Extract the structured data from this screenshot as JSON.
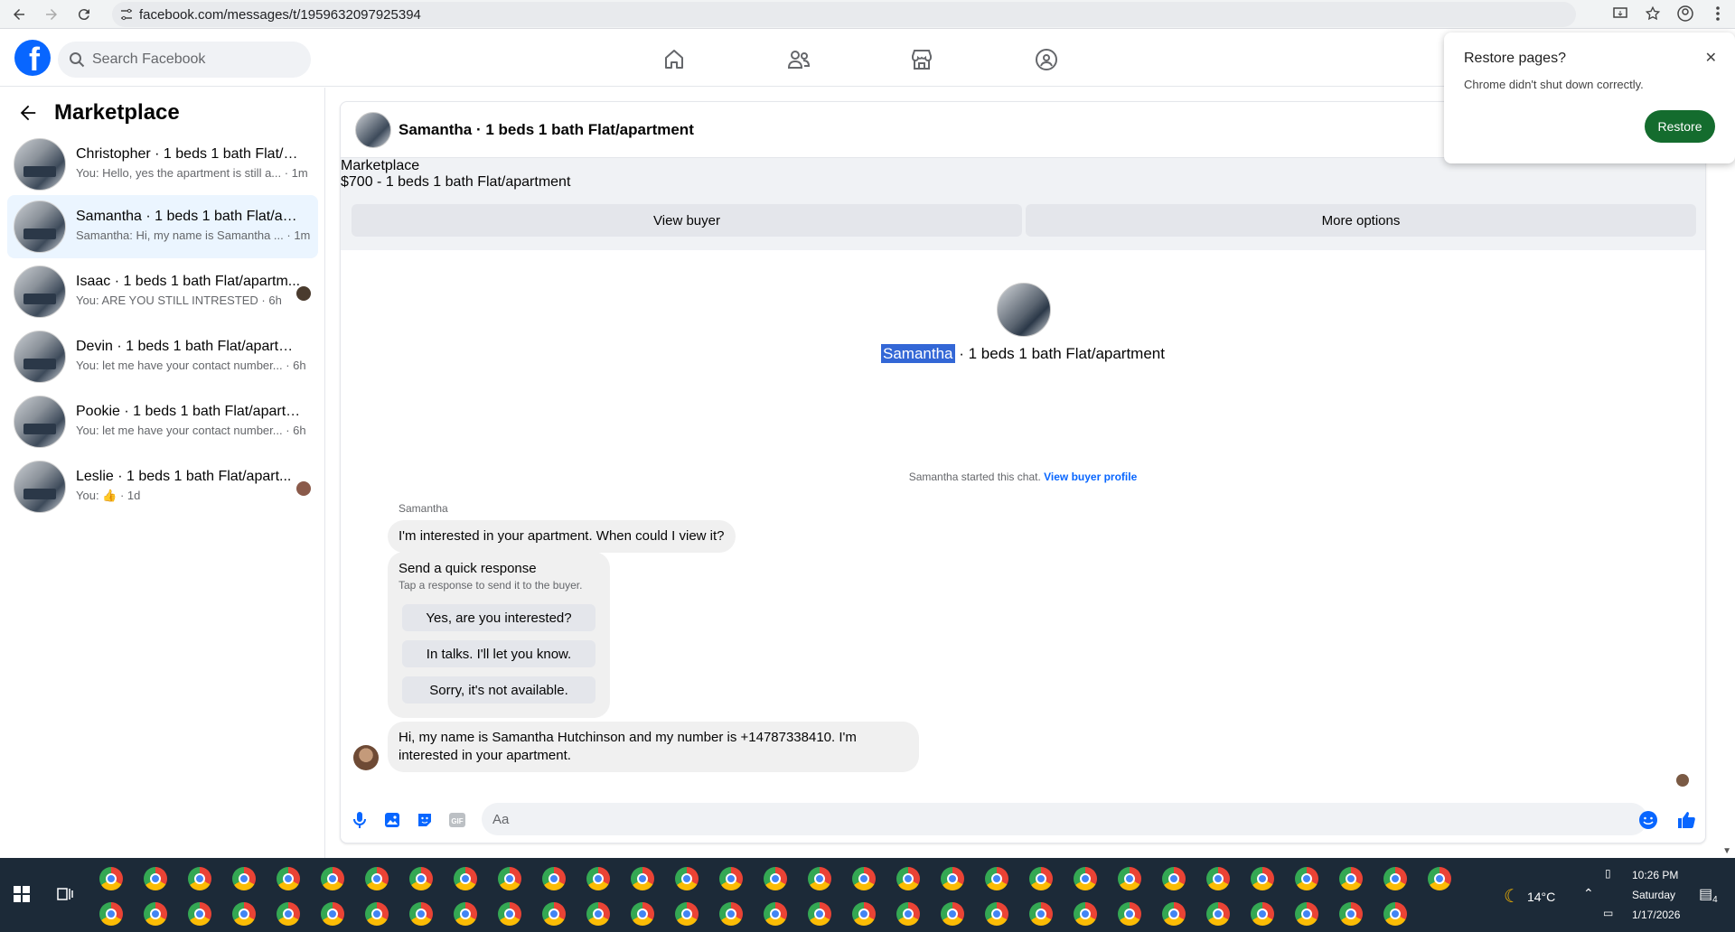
{
  "browser": {
    "url": "facebook.com/messages/t/1959632097925394"
  },
  "header": {
    "logo_letter": "f",
    "search_placeholder": "Search Facebook"
  },
  "sidebar": {
    "title": "Marketplace",
    "conversations": [
      {
        "name": "Christopher · 1 beds 1 bath Flat/ap...",
        "preview": "You: Hello, yes the apartment is still a... · 1m",
        "active": false
      },
      {
        "name": "Samantha · 1 beds 1 bath Flat/apar...",
        "preview": "Samantha: Hi, my name is Samantha ... · 1m",
        "active": true
      },
      {
        "name": "Isaac · 1 beds 1 bath Flat/apartm...",
        "preview": "You: ARE YOU STILL INTRESTED · 6h",
        "active": false
      },
      {
        "name": "Devin · 1 beds 1 bath Flat/apartment",
        "preview": "You: let me have your contact number... · 6h",
        "active": false
      },
      {
        "name": "Pookie · 1 beds 1 bath Flat/apartm...",
        "preview": "You: let me have your contact number... · 6h",
        "active": false
      },
      {
        "name": "Leslie · 1 beds 1 bath Flat/apart...",
        "preview": "You: 👍 · 1d",
        "active": false
      }
    ]
  },
  "chat": {
    "title": "Samantha · 1 beds 1 bath Flat/apartment",
    "listing_source": "Marketplace",
    "listing_price": "$700 - 1 beds 1 bath Flat/apartment",
    "view_buyer": "View buyer",
    "more_options": "More options",
    "center_name": "Samantha",
    "center_rest": " · 1 beds 1 bath Flat/apartment",
    "started_text": "Samantha started this chat. ",
    "view_buyer_profile": "View buyer profile",
    "sender": "Samantha",
    "message1": "I'm interested in your apartment. When could I view it?",
    "quick_title": "Send a quick response",
    "quick_sub": "Tap a response to send it to the buyer.",
    "quick_options": [
      "Yes, are you interested?",
      "In talks. I'll let you know.",
      "Sorry, it's not available."
    ],
    "message2": "Hi, my name is Samantha Hutchinson and my number is +14787338410. I'm interested in your apartment.",
    "composer_placeholder": "Aa"
  },
  "restore_popup": {
    "title": "Restore pages?",
    "subtitle": "Chrome didn't shut down correctly.",
    "button": "Restore",
    "close": "✕"
  },
  "taskbar": {
    "weather": "14°C",
    "time": "10:26 PM",
    "day": "Saturday",
    "date": "1/17/2026",
    "notifications": "4"
  },
  "colors": {
    "fb_blue": "#0866ff",
    "active_bg": "#ebf5ff",
    "restore_green": "#146c2e",
    "taskbar": "#1c2a38"
  }
}
